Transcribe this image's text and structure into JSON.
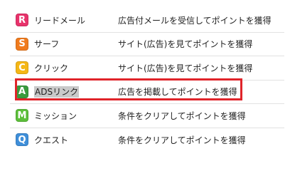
{
  "items": [
    {
      "icon_letter": "R",
      "icon_name": "r-icon",
      "icon_color": "#e8336b",
      "label": "リードメール",
      "label_selected": false,
      "desc": "広告付メールを受信してポイントを獲得"
    },
    {
      "icon_letter": "S",
      "icon_name": "s-icon",
      "icon_color": "#f07b1e",
      "label": "サーフ",
      "label_selected": false,
      "desc": "サイト(広告)を見てポイントを獲得"
    },
    {
      "icon_letter": "C",
      "icon_name": "c-icon",
      "icon_color": "#f5b716",
      "label": "クリック",
      "label_selected": false,
      "desc": "サイト(広告)を見てポイントを獲得"
    },
    {
      "icon_letter": "A",
      "icon_name": "a-icon",
      "icon_color": "#3a9b3e",
      "label": "ADSリンク",
      "label_selected": true,
      "desc": "広告を掲載してポイントを獲得"
    },
    {
      "icon_letter": "M",
      "icon_name": "m-icon",
      "icon_color": "#5cbf3a",
      "label": "ミッション",
      "label_selected": false,
      "desc": "条件をクリアしてポイントを獲得"
    },
    {
      "icon_letter": "Q",
      "icon_name": "q-icon",
      "icon_color": "#3f8fd9",
      "label": "クエスト",
      "label_selected": false,
      "desc": "条件をクリアしてポイントを獲得"
    }
  ],
  "highlight_color": "#e0242a",
  "selection_color": "#c9c9c9"
}
